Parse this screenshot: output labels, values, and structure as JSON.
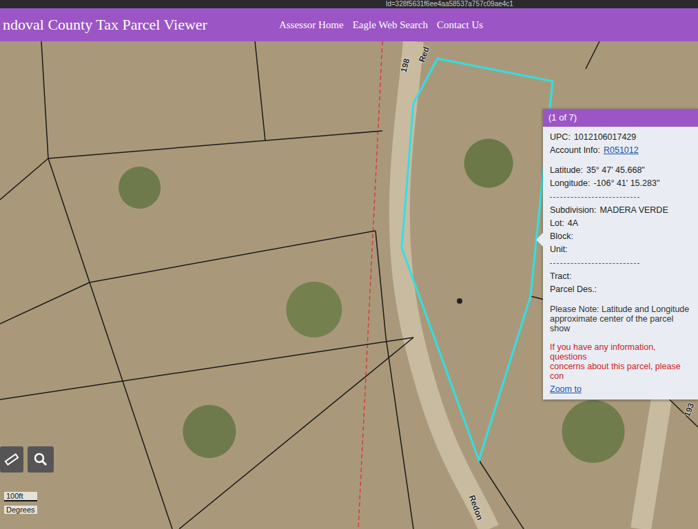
{
  "browser": {
    "url": "ld=328f5631f6ee4aa58537a757c09ae4c1"
  },
  "header": {
    "title": "ndoval County Tax Parcel Viewer",
    "links": [
      "Assessor Home",
      "Eagle Web Search",
      "Contact Us"
    ]
  },
  "map": {
    "road_labels": [
      "198",
      "Red",
      "Redon",
      "193"
    ],
    "scale": {
      "distance": "100ft",
      "units": "Degrees"
    }
  },
  "popup": {
    "counter": "(1 of 7)",
    "rows": [
      {
        "kind": "field",
        "label": "UPC:",
        "value": "1012106017429"
      },
      {
        "kind": "link",
        "label": "Account Info:",
        "value": "R051012"
      },
      {
        "kind": "field",
        "label": "Latitude:",
        "value": "35° 47' 45.668\""
      },
      {
        "kind": "field",
        "label": "Longitude:",
        "value": "-106° 41' 15.283\""
      },
      {
        "kind": "divider",
        "label": "",
        "value": ""
      },
      {
        "kind": "field",
        "label": "Subdivision:",
        "value": "MADERA VERDE"
      },
      {
        "kind": "field",
        "label": "Lot:",
        "value": "4A"
      },
      {
        "kind": "field",
        "label": "Block:",
        "value": ""
      },
      {
        "kind": "field",
        "label": "Unit:",
        "value": ""
      },
      {
        "kind": "divider",
        "label": "",
        "value": ""
      },
      {
        "kind": "field",
        "label": "Tract:",
        "value": ""
      },
      {
        "kind": "field",
        "label": "Parcel Des.:",
        "value": ""
      }
    ],
    "note": [
      "Please Note: Latitude and Longitude",
      "approximate center of the parcel show"
    ],
    "warning": [
      "If you have any information, questions",
      "concerns about this parcel, please con"
    ],
    "zoom": "Zoom to"
  }
}
